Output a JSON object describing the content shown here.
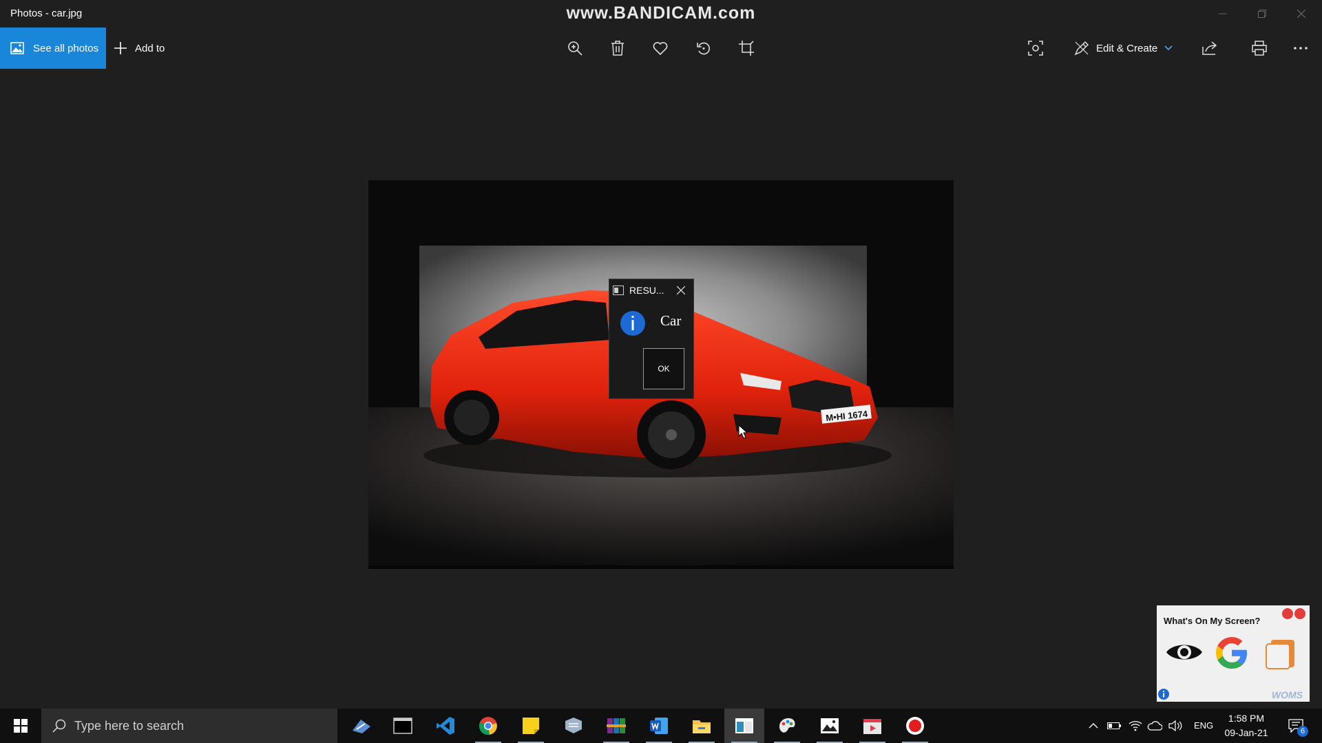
{
  "window": {
    "title": "Photos - car.jpg",
    "watermark": "www.BANDICAM.com"
  },
  "toolbar": {
    "see_all_label": "See all photos",
    "add_to_label": "Add to",
    "edit_create_label": "Edit & Create",
    "icons": [
      "zoom-icon",
      "delete-icon",
      "favorite-icon",
      "rotate-icon",
      "crop-icon",
      "visual-search-icon",
      "edit-icon",
      "share-icon",
      "print-icon",
      "more-icon"
    ]
  },
  "photo": {
    "plate_text": "M•HI 1674"
  },
  "dialog": {
    "title": "RESU...",
    "message": "Car",
    "ok_label": "OK"
  },
  "woms": {
    "title": "What's On My Screen?",
    "brand": "WOMS"
  },
  "taskbar": {
    "search_placeholder": "Type here to search",
    "language": "ENG",
    "time": "1:58 PM",
    "date": "09-Jan-21",
    "notification_count": "6"
  },
  "colors": {
    "accent": "#1a86d9",
    "background": "#1f1f1f",
    "taskbar": "#101010"
  }
}
